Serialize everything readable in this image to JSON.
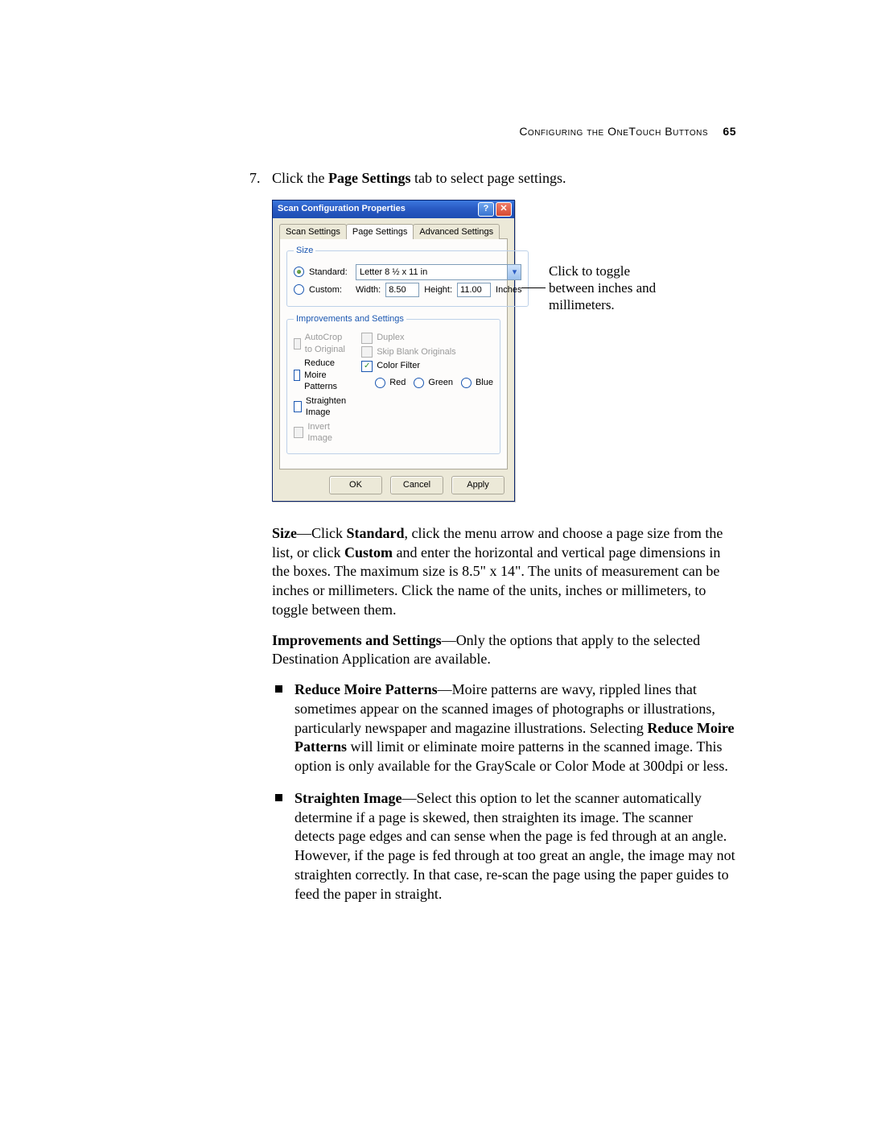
{
  "header": {
    "running": "Configuring the OneTouch Buttons",
    "page_number": "65"
  },
  "step": {
    "number": "7.",
    "text_before": "Click the ",
    "bold": "Page Settings",
    "text_after": " tab to select page settings."
  },
  "dialog": {
    "title": "Scan Configuration Properties",
    "help_glyph": "?",
    "close_glyph": "✕",
    "tabs": {
      "scan": "Scan Settings",
      "page": "Page Settings",
      "advanced": "Advanced Settings"
    },
    "size": {
      "legend": "Size",
      "standard_label": "Standard:",
      "paper_option": "Letter 8 ½ x 11 in",
      "custom_label": "Custom:",
      "width_label": "Width:",
      "width_value": "8.50",
      "height_label": "Height:",
      "height_value": "11.00",
      "units": "Inches"
    },
    "improve": {
      "legend": "Improvements and Settings",
      "autocrop": "AutoCrop to Original",
      "reduce_moire": "Reduce Moire Patterns",
      "straighten": "Straighten Image",
      "invert": "Invert Image",
      "duplex": "Duplex",
      "skip_blank": "Skip Blank Originals",
      "color_filter": "Color Filter",
      "red": "Red",
      "green": "Green",
      "blue": "Blue"
    },
    "buttons": {
      "ok": "OK",
      "cancel": "Cancel",
      "apply": "Apply"
    }
  },
  "callout": "Click to toggle between inches and millimeters.",
  "body": {
    "size": {
      "head": "Size",
      "t1": "—Click ",
      "b1": "Standard",
      "t2": ", click the menu arrow and choose a page size from the list, or click ",
      "b2": "Custom",
      "t3": " and enter the horizontal and vertical page dimensions in the boxes. The maximum size is 8.5\" x 14\". The units of measurement can be inches or millimeters. Click the name of the units, inches or millimeters, to toggle between them."
    },
    "improve": {
      "head": "Improvements and Settings",
      "t1": "—Only the options that apply to the selected Destination Application are available."
    },
    "bullets": {
      "moire": {
        "head": "Reduce Moire Patterns",
        "t1": "—Moire patterns are wavy, rippled lines that sometimes appear on the scanned images of photographs or illustrations, particularly newspaper and magazine illustrations. Selecting ",
        "b1": "Reduce Moire Patterns",
        "t2": " will limit or eliminate moire patterns in the scanned image. This option is only available for the GrayScale or Color Mode at 300dpi or less."
      },
      "straighten": {
        "head": "Straighten Image",
        "t1": "—Select this option to let the scanner automatically determine if a page is skewed, then straighten its image. The scanner detects page edges and can sense when the page is fed through at an angle. However, if the page is fed through at too great an angle, the image may not straighten correctly. In that case, re-scan the page using the paper guides to feed the paper in straight."
      }
    }
  }
}
